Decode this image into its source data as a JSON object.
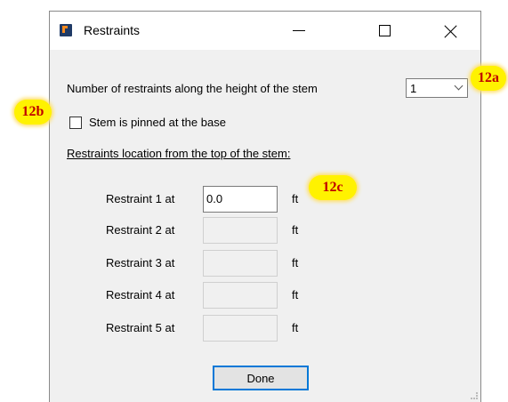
{
  "window": {
    "title": "Restraints",
    "icon": "app-icon",
    "controls": [
      "minimize-icon",
      "maximize-icon",
      "close-icon"
    ]
  },
  "restraints_count": {
    "label": "Number of restraints along the height of the stem",
    "value": "1"
  },
  "pinned": {
    "label": "Stem is pinned at the base",
    "checked": false
  },
  "section_heading": "Restraints location from the top of the stem:",
  "rows": [
    {
      "label": "Restraint 1 at",
      "value": "0.0",
      "unit": "ft",
      "enabled": true
    },
    {
      "label": "Restraint 2 at",
      "value": "",
      "unit": "ft",
      "enabled": false
    },
    {
      "label": "Restraint 3 at",
      "value": "",
      "unit": "ft",
      "enabled": false
    },
    {
      "label": "Restraint 4 at",
      "value": "",
      "unit": "ft",
      "enabled": false
    },
    {
      "label": "Restraint 5 at",
      "value": "",
      "unit": "ft",
      "enabled": false
    }
  ],
  "done_label": "Done",
  "callouts": {
    "a": "12a",
    "b": "12b",
    "c": "12c"
  },
  "colors": {
    "callout_bg": "#fff200",
    "callout_text": "#c00000",
    "focus_border": "#0078d7"
  }
}
